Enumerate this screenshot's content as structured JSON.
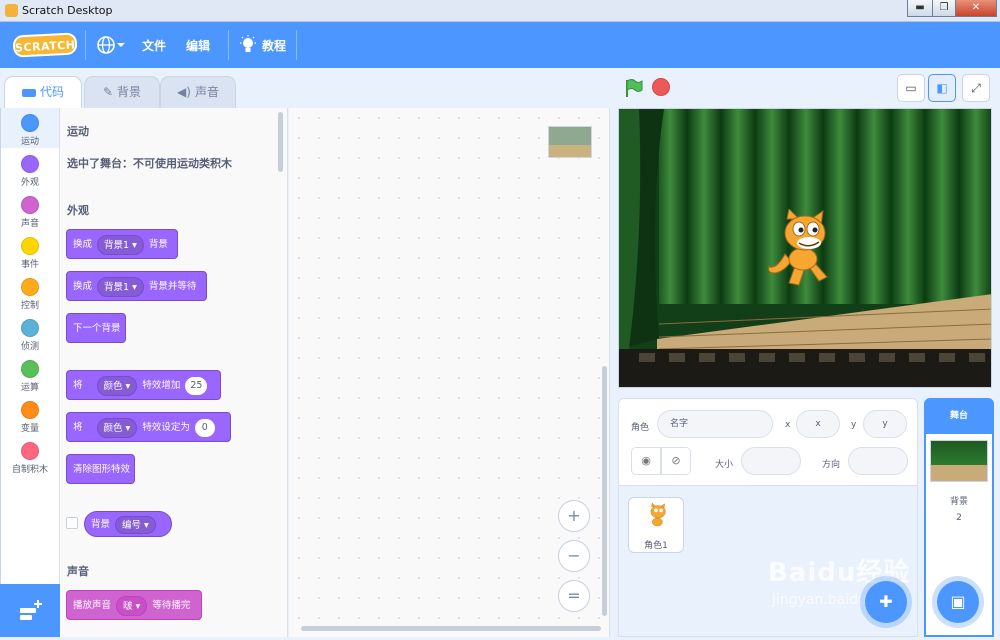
{
  "window": {
    "title": "Scratch Desktop",
    "min": "▬",
    "max": "❐",
    "close": "✕"
  },
  "menu": {
    "logo": "SCRATCH",
    "file": "文件",
    "edit": "编辑",
    "tutorials": "教程"
  },
  "tabs": {
    "code": "代码",
    "costumes": "背景",
    "sounds": "声音"
  },
  "categories": [
    {
      "label": "运动",
      "color": "#4c97ff"
    },
    {
      "label": "外观",
      "color": "#9966ff"
    },
    {
      "label": "声音",
      "color": "#cf63cf"
    },
    {
      "label": "事件",
      "color": "#ffd500"
    },
    {
      "label": "控制",
      "color": "#ffab19"
    },
    {
      "label": "侦测",
      "color": "#5cb1d6"
    },
    {
      "label": "运算",
      "color": "#59c059"
    },
    {
      "label": "变量",
      "color": "#ff8c1a"
    },
    {
      "label": "自制积木",
      "color": "#ff6680"
    }
  ],
  "palette": {
    "motion_heading": "运动",
    "motion_note": "选中了舞台：不可使用运动类积木",
    "looks_heading": "外观",
    "sound_heading": "声音",
    "b1": {
      "a": "换成",
      "dd": "背景1 ▾",
      "b": "背景"
    },
    "b2": {
      "a": "换成",
      "dd": "背景1 ▾",
      "b": "背景并等待"
    },
    "b3": {
      "a": "下一个背景"
    },
    "b4": {
      "a": "将",
      "dd": "颜色 ▾",
      "b": "特效增加",
      "num": "25"
    },
    "b5": {
      "a": "将",
      "dd": "颜色 ▾",
      "b": "特效设定为",
      "num": "0"
    },
    "b6": {
      "a": "清除图形特效"
    },
    "b7": {
      "a": "背景",
      "dd": "编号 ▾"
    },
    "b8": {
      "a": "播放声音",
      "dd": "啵 ▾",
      "b": "等待播完"
    }
  },
  "zoom": {
    "in": "+",
    "out": "−",
    "reset": "="
  },
  "sprite_info": {
    "sprite_label": "角色",
    "name_placeholder": "名字",
    "x_label": "x",
    "x_placeholder": "x",
    "y_label": "y",
    "y_placeholder": "y",
    "size_label": "大小",
    "direction_label": "方向"
  },
  "sprites": [
    {
      "name": "角色1"
    }
  ],
  "stage_panel": {
    "title": "舞台",
    "backdrops_label": "背景",
    "backdrops_count": "2"
  },
  "watermark": {
    "line1": "Baidu经验",
    "line2": "jingyan.baidu.com"
  }
}
